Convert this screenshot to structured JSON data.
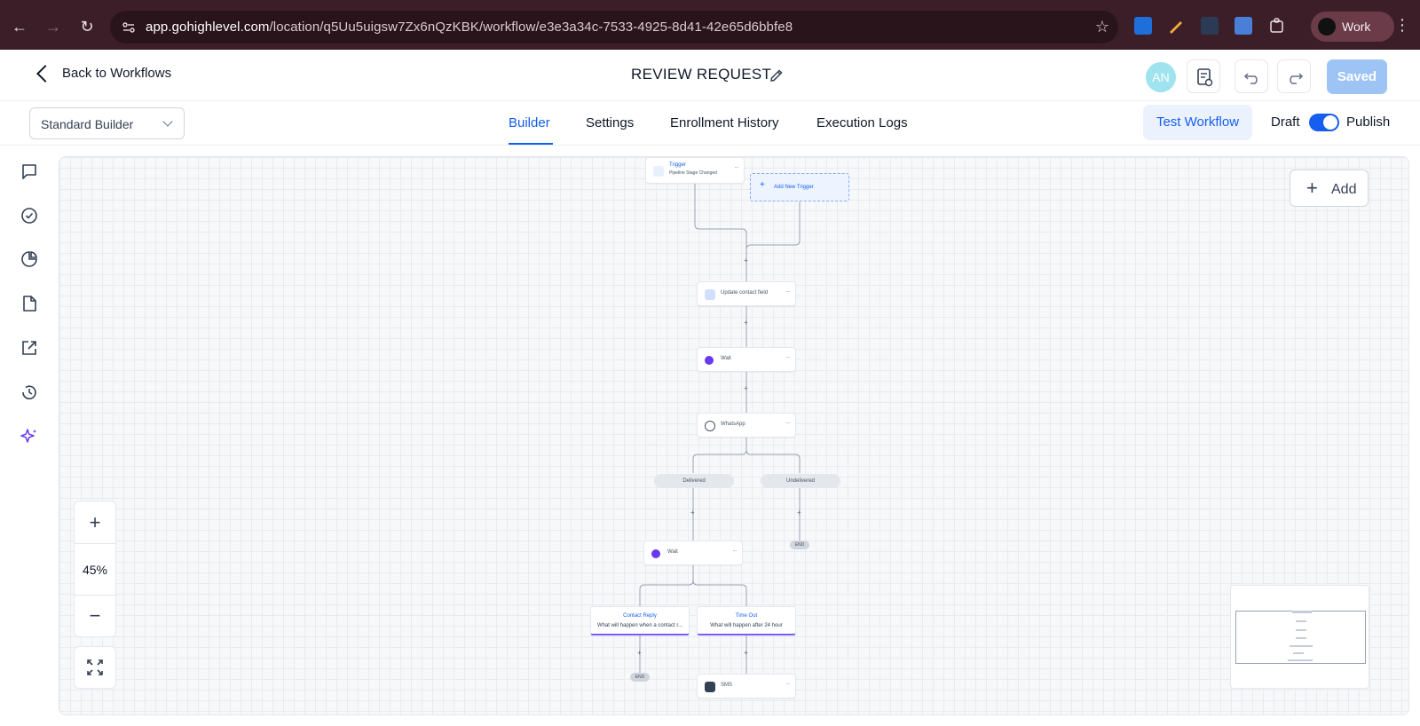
{
  "browser": {
    "url_host": "app.gohighlevel.com",
    "url_path": "/location/q5Uu5uigsw7Zx6nQzKBK/workflow/e3e3a34c-7533-4925-8d41-42e65d6bbfe8",
    "profile_label": "Work"
  },
  "header": {
    "back_label": "Back to Workflows",
    "title": "REVIEW REQUEST",
    "avatar_initials": "AN",
    "saved_label": "Saved"
  },
  "subheader": {
    "builder_select": "Standard Builder",
    "tabs": [
      {
        "label": "Builder",
        "active": true
      },
      {
        "label": "Settings",
        "active": false
      },
      {
        "label": "Enrollment History",
        "active": false
      },
      {
        "label": "Execution Logs",
        "active": false
      }
    ],
    "test_workflow_label": "Test Workflow",
    "draft_label": "Draft",
    "publish_label": "Publish",
    "publish_toggle_on": true
  },
  "rail": {
    "icons": [
      "chat-icon",
      "check-circle-icon",
      "pie-chart-icon",
      "document-icon",
      "external-link-icon",
      "history-icon",
      "sparkles-icon"
    ]
  },
  "canvas": {
    "add_label": "Add",
    "zoom_level": "45%",
    "trigger": {
      "title": "Trigger",
      "subtitle": "Pipeline Stage Changed"
    },
    "add_trigger_label": "Add New Trigger",
    "nodes": {
      "update": "Update contact field",
      "wait1": "Wait",
      "whatsapp": "WhatsApp",
      "wait2": "Wait",
      "sms": "SMS"
    },
    "branches": {
      "delivered": "Delivered",
      "undelivered": "Undelivered",
      "end": "END"
    },
    "reply_branch": {
      "title": "Contact Reply",
      "desc": "What will happen when a contact r..."
    },
    "timeout_branch": {
      "title": "Time Out",
      "desc": "What will happen after 24 hour"
    }
  },
  "colors": {
    "accent": "#155eef",
    "saved_button": "#9ec3f5",
    "browser_chrome": "#3c1e28",
    "wait_icon": "#6938ef",
    "branch_underline": "#7a5af8"
  }
}
